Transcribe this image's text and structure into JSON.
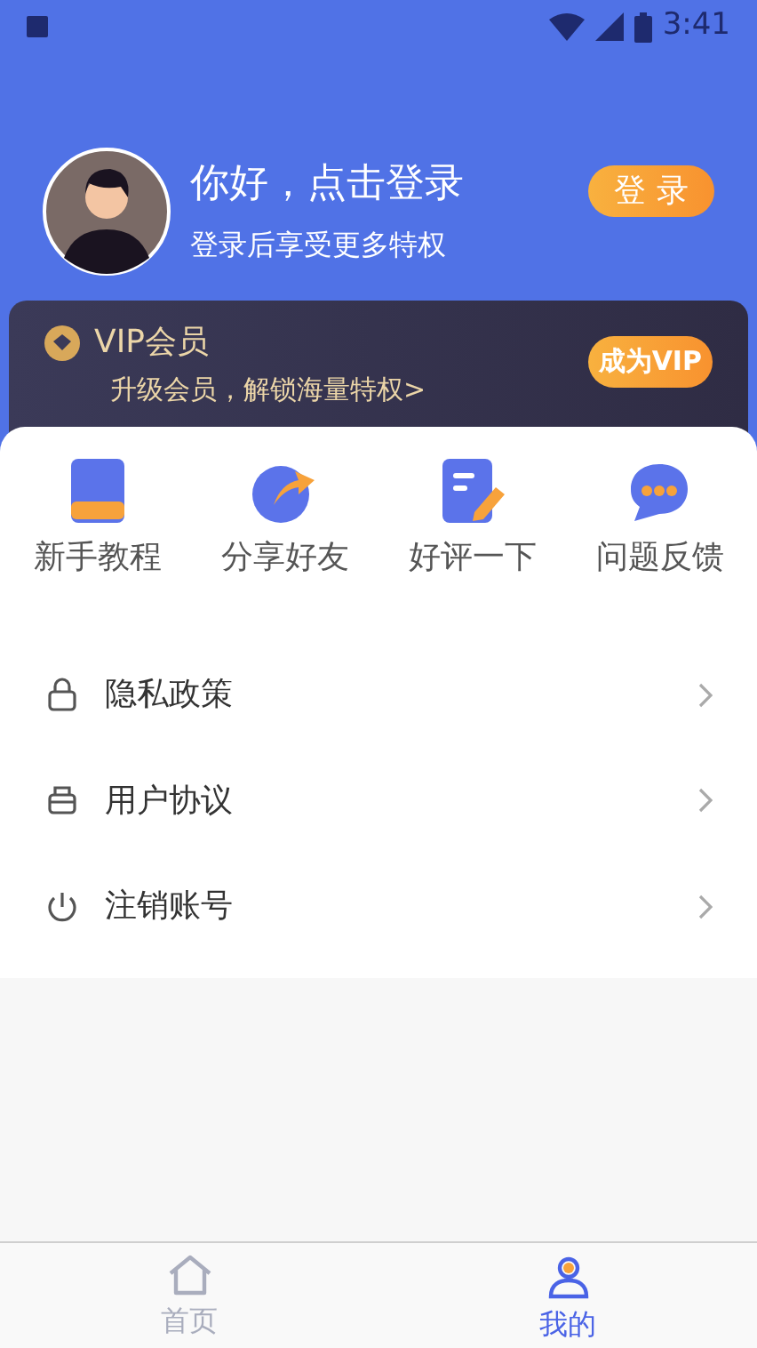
{
  "status_bar": {
    "time": "3:41"
  },
  "profile": {
    "greeting": "你好，点击登录",
    "subtitle": "登录后享受更多特权",
    "login_button": "登 录"
  },
  "vip_card": {
    "title": "VIP会员",
    "subtitle": "升级会员，解锁海量特权>",
    "button": "成为VIP"
  },
  "shortcuts": [
    {
      "kind": "book",
      "label": "新手教程"
    },
    {
      "kind": "share",
      "label": "分享好友"
    },
    {
      "kind": "note",
      "label": "好评一下"
    },
    {
      "kind": "chat",
      "label": "问题反馈"
    }
  ],
  "menu": [
    {
      "kind": "lock",
      "label": "隐私政策"
    },
    {
      "kind": "doc",
      "label": "用户协议"
    },
    {
      "kind": "power",
      "label": "注销账号"
    }
  ],
  "bottom_nav": [
    {
      "kind": "home",
      "label": "首页",
      "selected": false
    },
    {
      "kind": "user",
      "label": "我的",
      "selected": true
    }
  ]
}
